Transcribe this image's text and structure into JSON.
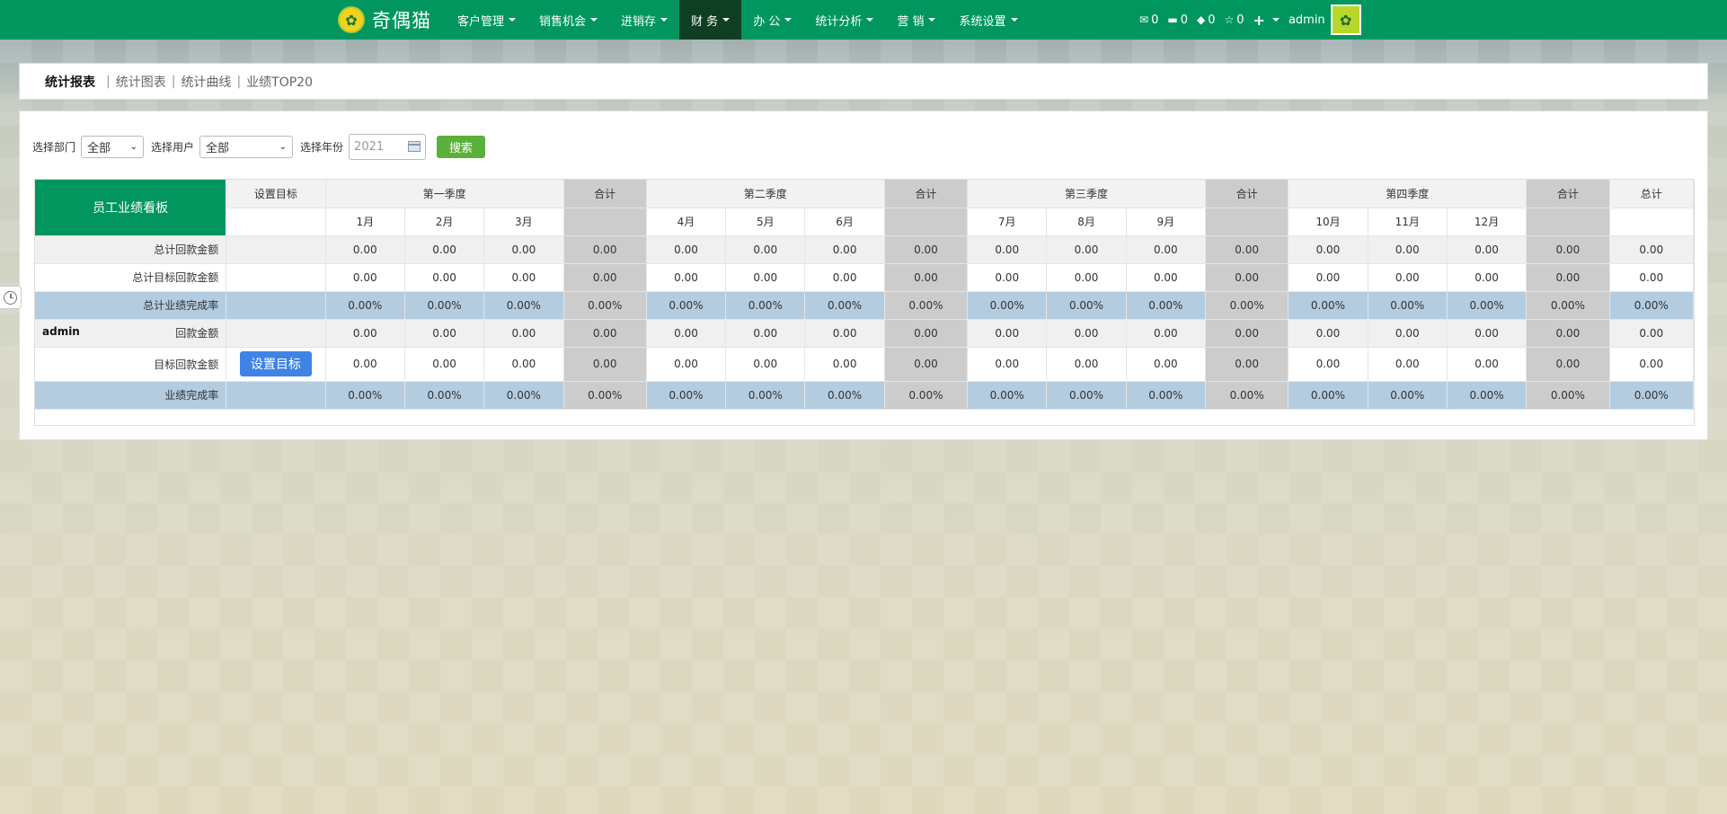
{
  "app": {
    "brand": "奇偶猫"
  },
  "nav": {
    "items": [
      {
        "label": "客户管理",
        "active": false
      },
      {
        "label": "销售机会",
        "active": false
      },
      {
        "label": "进销存",
        "active": false
      },
      {
        "label": "财 务",
        "active": true
      },
      {
        "label": "办 公",
        "active": false
      },
      {
        "label": "统计分析",
        "active": false
      },
      {
        "label": "营 销",
        "active": false
      },
      {
        "label": "系统设置",
        "active": false
      }
    ],
    "counters": {
      "mail": "0",
      "message": "0",
      "task": "0",
      "star": "0"
    },
    "user": "admin"
  },
  "tabs": {
    "items": [
      {
        "label": "统计报表",
        "active": true
      },
      {
        "label": "统计图表",
        "active": false
      },
      {
        "label": "统计曲线",
        "active": false
      },
      {
        "label": "业绩TOP20",
        "active": false
      }
    ]
  },
  "filters": {
    "dept_label": "选择部门",
    "dept_value": "全部",
    "user_label": "选择用户",
    "user_value": "全部",
    "year_label": "选择年份",
    "year_placeholder": "2021",
    "search_button": "搜索"
  },
  "table": {
    "board_title": "员工业绩看板",
    "set_target_header": "设置目标",
    "quarter_headers": [
      "第一季度",
      "第二季度",
      "第三季度",
      "第四季度"
    ],
    "subtotal_header": "合计",
    "total_header": "总计",
    "months": [
      "1月",
      "2月",
      "3月",
      "4月",
      "5月",
      "6月",
      "7月",
      "8月",
      "9月",
      "10月",
      "11月",
      "12月"
    ],
    "rows": [
      {
        "user": "",
        "label": "总计回款金额",
        "style": "gray",
        "has_button": false,
        "values": [
          "0.00",
          "0.00",
          "0.00",
          "0.00",
          "0.00",
          "0.00",
          "0.00",
          "0.00",
          "0.00",
          "0.00",
          "0.00",
          "0.00",
          "0.00",
          "0.00",
          "0.00",
          "0.00",
          "0.00"
        ]
      },
      {
        "user": "",
        "label": "总计目标回款金额",
        "style": "white",
        "has_button": false,
        "values": [
          "0.00",
          "0.00",
          "0.00",
          "0.00",
          "0.00",
          "0.00",
          "0.00",
          "0.00",
          "0.00",
          "0.00",
          "0.00",
          "0.00",
          "0.00",
          "0.00",
          "0.00",
          "0.00",
          "0.00"
        ]
      },
      {
        "user": "",
        "label": "总计业绩完成率",
        "style": "blue",
        "has_button": false,
        "values": [
          "0.00%",
          "0.00%",
          "0.00%",
          "0.00%",
          "0.00%",
          "0.00%",
          "0.00%",
          "0.00%",
          "0.00%",
          "0.00%",
          "0.00%",
          "0.00%",
          "0.00%",
          "0.00%",
          "0.00%",
          "0.00%",
          "0.00%"
        ]
      },
      {
        "user": "admin",
        "label": "回款金额",
        "style": "gray",
        "has_button": false,
        "values": [
          "0.00",
          "0.00",
          "0.00",
          "0.00",
          "0.00",
          "0.00",
          "0.00",
          "0.00",
          "0.00",
          "0.00",
          "0.00",
          "0.00",
          "0.00",
          "0.00",
          "0.00",
          "0.00",
          "0.00"
        ]
      },
      {
        "user": "",
        "label": "目标回款金额",
        "style": "white",
        "has_button": true,
        "button_label": "设置目标",
        "values": [
          "0.00",
          "0.00",
          "0.00",
          "0.00",
          "0.00",
          "0.00",
          "0.00",
          "0.00",
          "0.00",
          "0.00",
          "0.00",
          "0.00",
          "0.00",
          "0.00",
          "0.00",
          "0.00",
          "0.00"
        ]
      },
      {
        "user": "",
        "label": "业绩完成率",
        "style": "blue",
        "has_button": false,
        "values": [
          "0.00%",
          "0.00%",
          "0.00%",
          "0.00%",
          "0.00%",
          "0.00%",
          "0.00%",
          "0.00%",
          "0.00%",
          "0.00%",
          "0.00%",
          "0.00%",
          "0.00%",
          "0.00%",
          "0.00%",
          "0.00%",
          "0.00%"
        ]
      }
    ]
  }
}
